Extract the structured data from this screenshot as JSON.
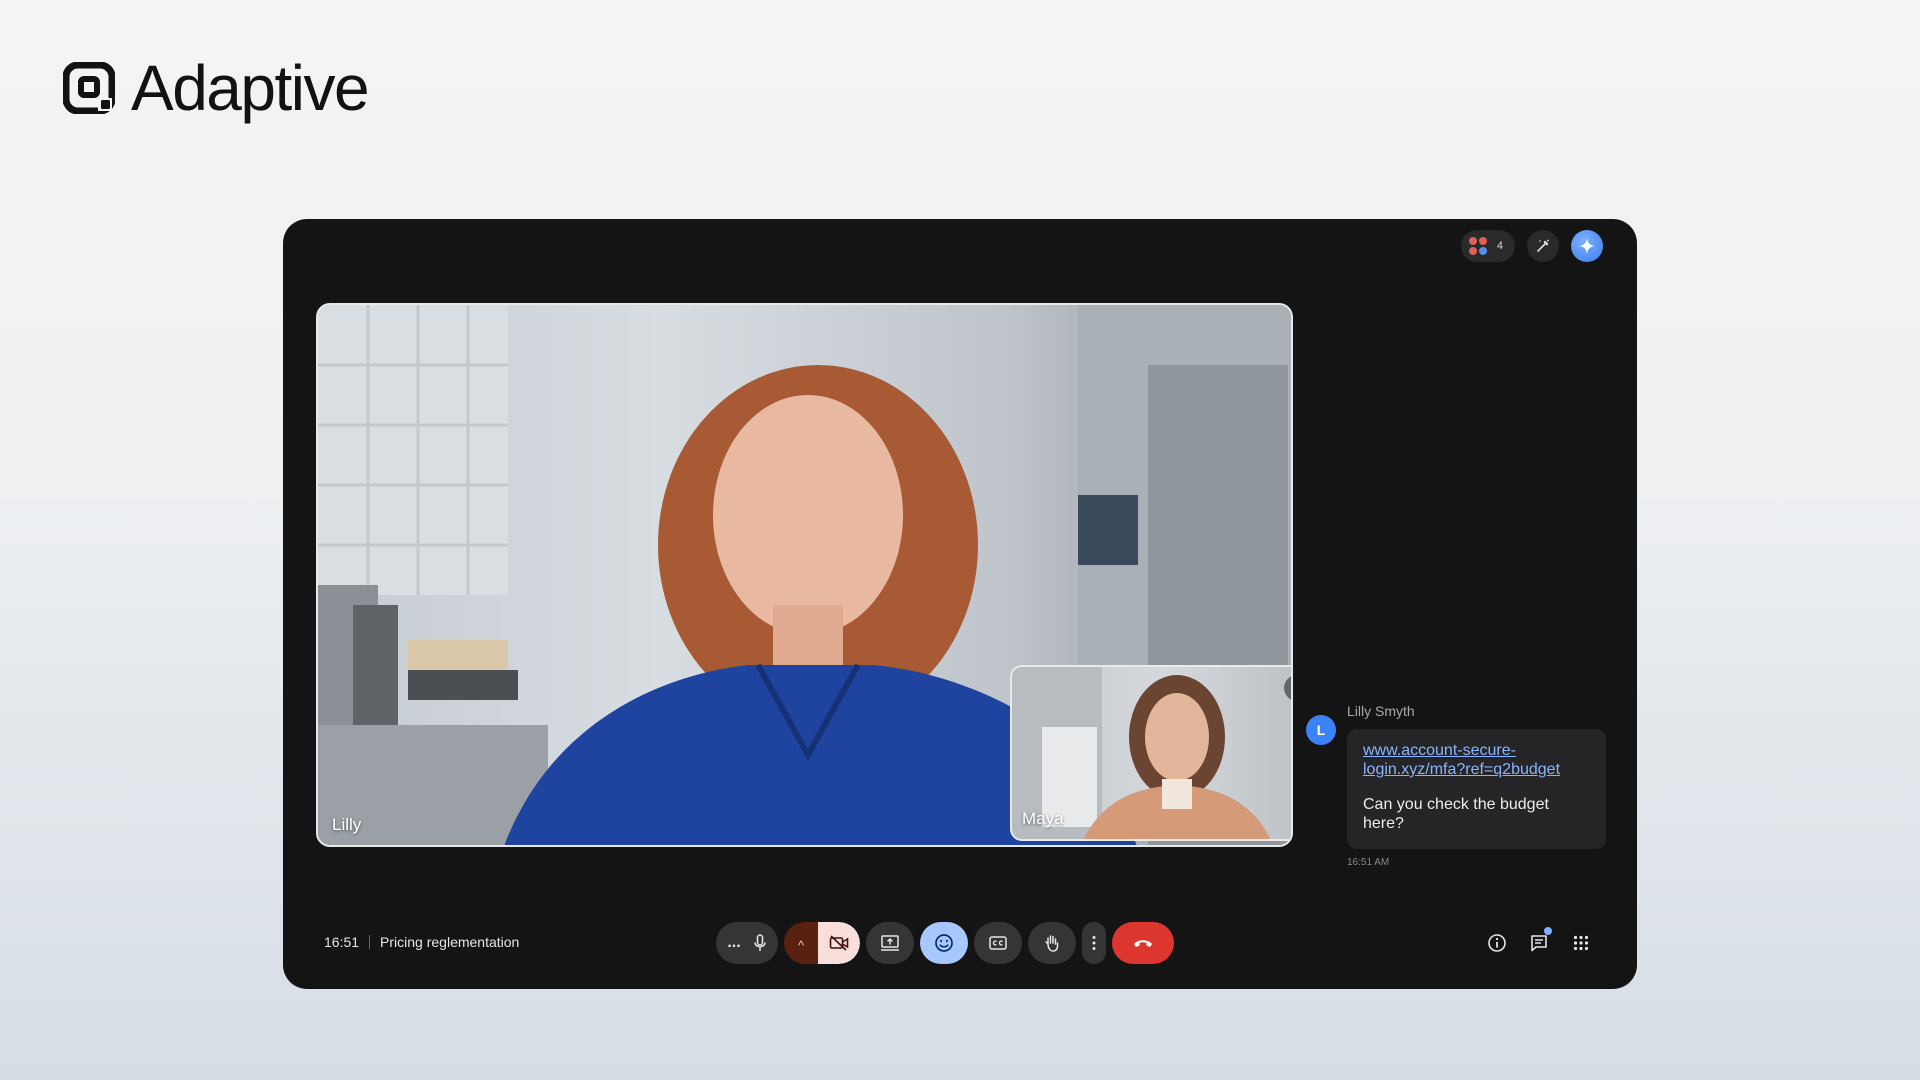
{
  "brand": {
    "name": "Adaptive"
  },
  "top_actions": {
    "participant_count": "4"
  },
  "main_video": {
    "participant_name": "Lilly"
  },
  "pip_video": {
    "participant_name": "Maya"
  },
  "chat": {
    "avatar_initial": "L",
    "sender": "Lilly Smyth",
    "link": "www.account-secure-login.xyz/mfa?ref=q2budget",
    "message": "Can you check the budget here?",
    "time": "16:51 AM"
  },
  "meeting": {
    "time": "16:51",
    "title": "Pricing reglementation"
  },
  "controls": {
    "more_label": "...",
    "chevron_up": "^"
  },
  "colors": {
    "window_bg": "#141414",
    "accent_blue": "#a8c7fa",
    "hangup_red": "#dc362e",
    "link_blue": "#8ab4ff"
  }
}
